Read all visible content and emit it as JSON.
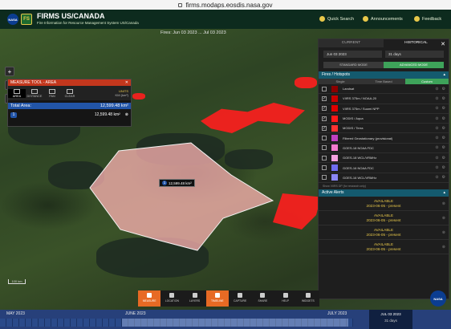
{
  "browser": {
    "url": "firms.modaps.eosdis.nasa.gov"
  },
  "header": {
    "nasa_logo": "NASA",
    "fs_logo": "FS",
    "title": "FIRMS US/CANADA",
    "subtitle": "Fire Information for Resource Management System US/Canada",
    "links": [
      {
        "label": "Quick Search",
        "icon": "search-icon"
      },
      {
        "label": "Announcements",
        "icon": "megaphone-icon"
      },
      {
        "label": "Feedback",
        "icon": "chat-icon"
      }
    ]
  },
  "map": {
    "fires_label": "Fires: Jun 03 2023 ... Jul 03 2023",
    "left_tools": [
      {
        "label": "+",
        "icon": "zoom-in-icon"
      },
      {
        "label": "≡",
        "icon": "layers-icon"
      },
      {
        "label": "⌖",
        "icon": "location-icon"
      }
    ],
    "scale_label": "100 km"
  },
  "measure_tool": {
    "title": "MEASURE TOOL - AREA",
    "tools": [
      "AREA",
      "DISTANCE",
      "PAN",
      "CLEAR"
    ],
    "units_label": "UNITS",
    "units_value": "KM (km²)",
    "total_label": "Total Area:",
    "total_value": "12,599.48 km²",
    "item_index": "1",
    "item_value": "12,599.48 km²"
  },
  "polygon_label": "12,599.48 km²",
  "right_panel": {
    "tabs": [
      "CURRENT",
      "HISTORICAL"
    ],
    "active_tab": "HISTORICAL",
    "date_from": "Jun 03 2023",
    "date_span": "31 days",
    "modes": [
      "STANDARD MODE",
      "ADVANCED MODE"
    ],
    "active_mode": "ADVANCED MODE",
    "fires_section": "Fires / Hotspots",
    "filter_tabs": [
      "Single",
      "Time Based",
      "Custom"
    ],
    "active_filter": "Custom",
    "layers": [
      {
        "label": "Landsat",
        "color": "#8b0000",
        "checked": false
      },
      {
        "label": "VIIRS 375m / NOAA-20",
        "color": "#c80000",
        "checked": true
      },
      {
        "label": "VIIRS 375m / Suomi NPP",
        "color": "#e00000",
        "checked": true
      },
      {
        "label": "MODIS / Aqua",
        "color": "#ff1a1a",
        "checked": true
      },
      {
        "label": "MODIS / Terra",
        "color": "#ff3333",
        "checked": true
      },
      {
        "label": "Filtered Geostationary (provisional)",
        "color": "#c040c0",
        "checked": false
      },
      {
        "label": "GOES-18 NOAA FDC",
        "color": "#f47ad0",
        "checked": false
      },
      {
        "label": "GOES-18 WCL/VRMHz",
        "color": "#f5a0e0",
        "checked": false
      },
      {
        "label": "GOES-16 NOAA FDC",
        "color": "#6f6cf0",
        "checked": false
      },
      {
        "label": "GOES-16 WCL/VRMHz",
        "color": "#8a86f6",
        "checked": false
      }
    ],
    "show_note": "Show VIIRS DP (for research only)",
    "alerts_section": "Active Alerts",
    "alerts": [
      {
        "title": "AVAILABLE",
        "dates": "2023-06-05 - present"
      },
      {
        "title": "AVAILABLE",
        "dates": "2023-06-05 - present"
      },
      {
        "title": "AVAILABLE",
        "dates": "2023-06-05 - present"
      },
      {
        "title": "AVAILABLE",
        "dates": "2023-06-05 - present"
      }
    ]
  },
  "bottom_tools": [
    {
      "label": "MEASURE",
      "active": true
    },
    {
      "label": "LOCATION",
      "active": false
    },
    {
      "label": "LAYERS",
      "active": false
    },
    {
      "label": "TIMELINE",
      "active": true
    },
    {
      "label": "CAPTURE",
      "active": false
    },
    {
      "label": "SHARE",
      "active": false
    },
    {
      "label": "HELP",
      "active": false
    },
    {
      "label": "WIDGETS",
      "active": false
    }
  ],
  "timeline": {
    "months": [
      "MAY 2023",
      "JUNE 2023",
      "JULY 2023"
    ],
    "date_info_top": "JUL 03 2023",
    "date_info_bottom": "31 days"
  },
  "corner_logo": "NASA"
}
